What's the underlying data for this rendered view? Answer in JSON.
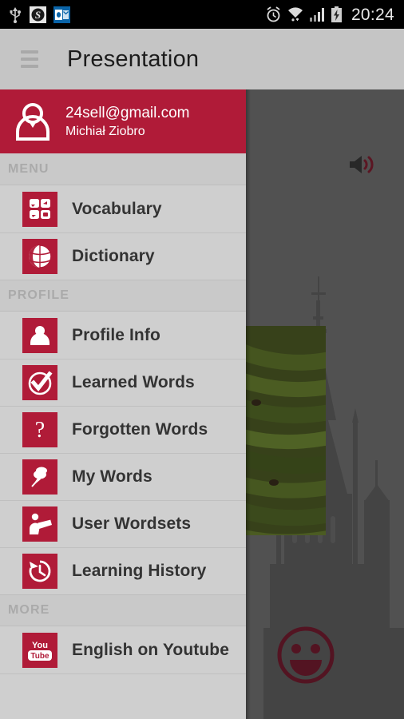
{
  "statusbar": {
    "time": "20:24",
    "left_icons": [
      "usb-icon",
      "skype-icon",
      "outlook-icon"
    ],
    "right_icons": [
      "alarm-icon",
      "wifi-icon",
      "signal-icon",
      "battery-charging-icon"
    ]
  },
  "actionbar": {
    "menu_icon": "hamburger-icon",
    "title": "Presentation"
  },
  "drawer": {
    "account": {
      "avatar_icon": "person-icon",
      "email": "24sell@gmail.com",
      "name": "Michiał Ziobro"
    },
    "sections": [
      {
        "header": "MENU",
        "items": [
          {
            "label": "Vocabulary",
            "icon": "grid-tiles-icon"
          },
          {
            "label": "Dictionary",
            "icon": "globe-icon"
          }
        ]
      },
      {
        "header": "PROFILE",
        "items": [
          {
            "label": "Profile Info",
            "icon": "person-icon"
          },
          {
            "label": "Learned Words",
            "icon": "check-circle-icon"
          },
          {
            "label": "Forgotten Words",
            "icon": "question-mark-icon"
          },
          {
            "label": "My Words",
            "icon": "pushpin-icon"
          },
          {
            "label": "User Wordsets",
            "icon": "person-reading-icon"
          },
          {
            "label": "Learning History",
            "icon": "clock-history-icon"
          }
        ]
      },
      {
        "header": "MORE",
        "items": [
          {
            "label": "English on Youtube",
            "icon": "youtube-icon"
          }
        ]
      }
    ]
  },
  "content": {
    "speaker_icon": "speaker-sound-icon",
    "smiley_icon": "smiley-face-icon",
    "word_image": "green-bananas-photo",
    "background_image": "cathedral-tower-photo"
  },
  "colors": {
    "accent_red": "#b01b38",
    "drawer_bg": "#cfcfcf",
    "actionbar_bg": "#c5c5c5",
    "section_header_bg": "#c9c9c9",
    "content_dim": "#6b6b6b",
    "statusbar_bg": "#000000"
  }
}
